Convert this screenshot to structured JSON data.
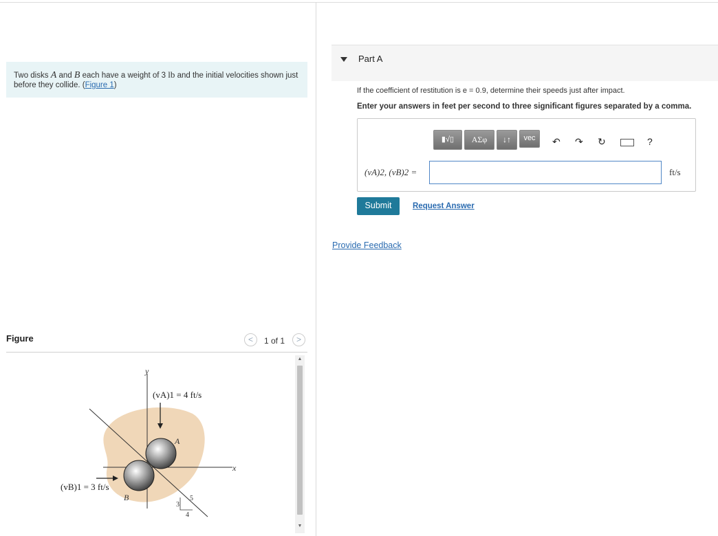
{
  "problem": {
    "text_prefix": "Two disks ",
    "var_a": "A",
    "text_and": " and ",
    "var_b": "B",
    "text_mid": " each have a weight of 3 ",
    "unit_lb": "lb",
    "text_suffix": " and the initial velocities shown just before they collide. (",
    "figure_link": "Figure 1",
    "text_close": ")"
  },
  "figure": {
    "title": "Figure",
    "pager": "1 of 1",
    "prev_glyph": "<",
    "next_glyph": ">",
    "labels": {
      "y_axis": "y",
      "x_axis": "x",
      "va1": "(vA)1 = 4 ft/s",
      "vb1": "(vB)1 = 3 ft/s",
      "disk_a": "A",
      "disk_b": "B",
      "slope_3": "3",
      "slope_4": "4",
      "slope_5": "5"
    }
  },
  "part_a": {
    "title": "Part A",
    "question": "If the coefficient of restitution is e = 0.9, determine their speeds just after impact.",
    "instruction": "Enter your answers in feet per second to three significant figures separated by a comma.",
    "toolbar": {
      "templates": "▮√▯",
      "greek": "ΑΣφ",
      "arrows": "↓↑",
      "vec": "vec",
      "help": "?"
    },
    "answer_label": "(vA)2, (vB)2 =",
    "answer_value": "",
    "unit": "ft/s",
    "submit": "Submit",
    "request_answer": "Request Answer"
  },
  "feedback": "Provide Feedback",
  "colors": {
    "intro_bg": "#e8f4f6",
    "link": "#2a6bb0",
    "submit_bg": "#1f7a9a",
    "blob": "#f0d7b8"
  }
}
